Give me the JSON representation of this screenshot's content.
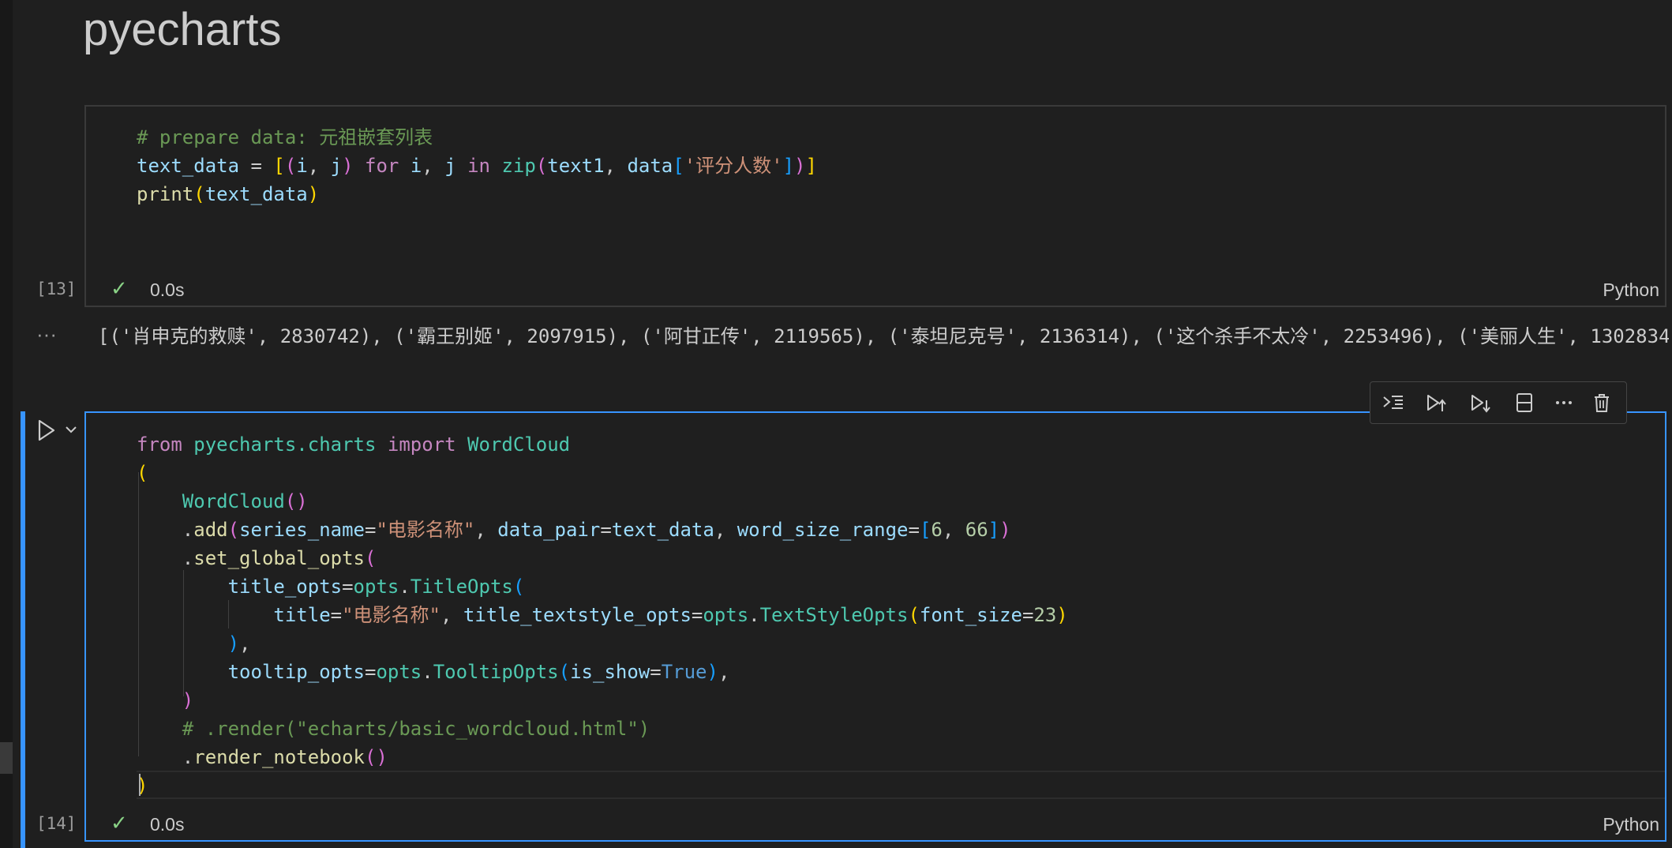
{
  "notebook": {
    "heading": "pyecharts",
    "cells": [
      {
        "exec_count": "[13]",
        "status": "0.0s",
        "language": "Python",
        "code_lines": [
          "# prepare data: 元祖嵌套列表",
          "text_data = [(i, j) for i, j in zip(text1, data['评分人数'])]",
          "print(text_data)"
        ],
        "output_prefix": "···",
        "output": "[('肖申克的救赎', 2830742), ('霸王别姬', 2097915), ('阿甘正传', 2119565), ('泰坦尼克号', 2136314), ('这个杀手不太冷', 2253496), ('美丽人生', 1302834"
      },
      {
        "exec_count": "[14]",
        "status": "0.0s",
        "language": "Python",
        "code_lines": [
          "from pyecharts.charts import WordCloud",
          "(",
          "    WordCloud()",
          "    .add(series_name=\"电影名称\", data_pair=text_data, word_size_range=[6, 66])",
          "    .set_global_opts(",
          "        title_opts=opts.TitleOpts(",
          "            title=\"电影名称\", title_textstyle_opts=opts.TextStyleOpts(font_size=23)",
          "        ),",
          "        tooltip_opts=opts.TooltipOpts(is_show=True),",
          "    )",
          "    # .render(\"echarts/basic_wordcloud.html\")",
          "    .render_notebook()",
          ")"
        ]
      }
    ],
    "toolbar_icons": [
      "run-by-line-icon",
      "execute-above-icon",
      "execute-below-icon",
      "split-cell-icon",
      "more-icon",
      "delete-icon"
    ],
    "colors": {
      "accent": "#3794ff",
      "background": "#1f1f1f",
      "success": "#89d185"
    }
  }
}
